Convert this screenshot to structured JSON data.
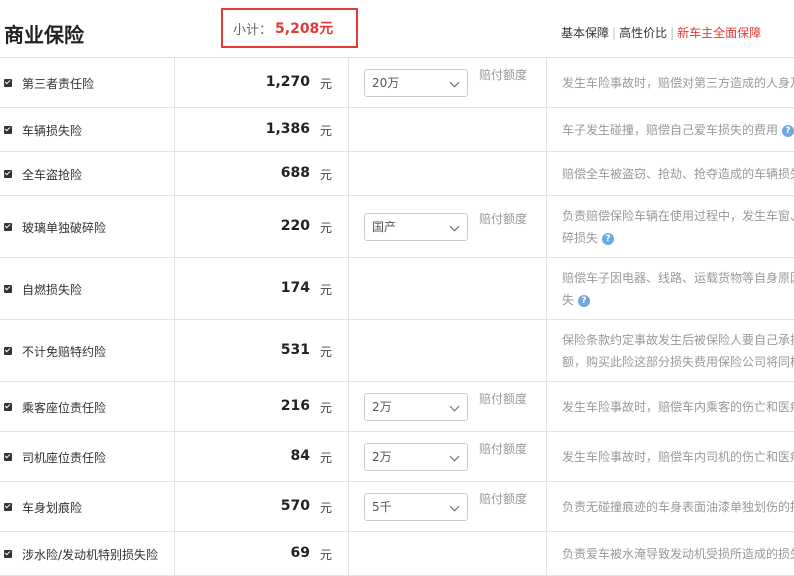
{
  "header": {
    "title": "商业保险",
    "subtotal_label": "小计：",
    "subtotal_value": "5,208元",
    "plans": [
      "基本保障",
      "高性价比",
      "新车主全面保障"
    ]
  },
  "colors": {
    "accent": "#e53935",
    "help_icon": "#6fa8dc"
  },
  "rows": [
    {
      "name": "第三者责任险",
      "amount": "1,270",
      "unit": "元",
      "select": "20万",
      "limit": "赔付额度",
      "desc": [
        "发生车险事故时，赔偿对第三方造成的人身及"
      ],
      "help": false,
      "checked": true
    },
    {
      "name": "车辆损失险",
      "amount": "1,386",
      "unit": "元",
      "select": "",
      "limit": "",
      "desc": [
        "车子发生碰撞，赔偿自己爱车损失的费用"
      ],
      "help": true,
      "checked": true
    },
    {
      "name": "全车盗抢险",
      "amount": "688",
      "unit": "元",
      "select": "",
      "limit": "",
      "desc": [
        "赔偿全车被盗窃、抢劫、抢夺造成的车辆损失"
      ],
      "help": false,
      "checked": true
    },
    {
      "name": "玻璃单独破碎险",
      "amount": "220",
      "unit": "元",
      "select": "国产",
      "limit": "赔付额度",
      "desc": [
        "负责赔偿保险车辆在使用过程中，发生车窗、",
        "碎损失"
      ],
      "help": true,
      "checked": true
    },
    {
      "name": "自燃损失险",
      "amount": "174",
      "unit": "元",
      "select": "",
      "limit": "",
      "desc": [
        "赔偿车子因电器、线路、运载货物等自身原因",
        "失"
      ],
      "help": true,
      "checked": true
    },
    {
      "name": "不计免赔特约险",
      "amount": "531",
      "unit": "元",
      "select": "",
      "limit": "",
      "desc": [
        "保险条款约定事故发生后被保险人要自己承担",
        "额，购买此险这部分损失费用保险公司将同样"
      ],
      "help": false,
      "checked": true
    },
    {
      "name": "乘客座位责任险",
      "amount": "216",
      "unit": "元",
      "select": "2万",
      "limit": "赔付额度",
      "desc": [
        "发生车险事故时，赔偿车内乘客的伤亡和医疗"
      ],
      "help": false,
      "checked": true
    },
    {
      "name": "司机座位责任险",
      "amount": "84",
      "unit": "元",
      "select": "2万",
      "limit": "赔付额度",
      "desc": [
        "发生车险事故时，赔偿车内司机的伤亡和医疗"
      ],
      "help": false,
      "checked": true
    },
    {
      "name": "车身划痕险",
      "amount": "570",
      "unit": "元",
      "select": "5千",
      "limit": "赔付额度",
      "desc": [
        "负责无碰撞痕迹的车身表面油漆单独划伤的损"
      ],
      "help": false,
      "checked": true
    },
    {
      "name": "涉水险/发动机特别损失险",
      "amount": "69",
      "unit": "元",
      "select": "",
      "limit": "",
      "desc": [
        "负责爱车被水淹导致发动机受损所造成的损失"
      ],
      "help": false,
      "checked": true
    }
  ]
}
